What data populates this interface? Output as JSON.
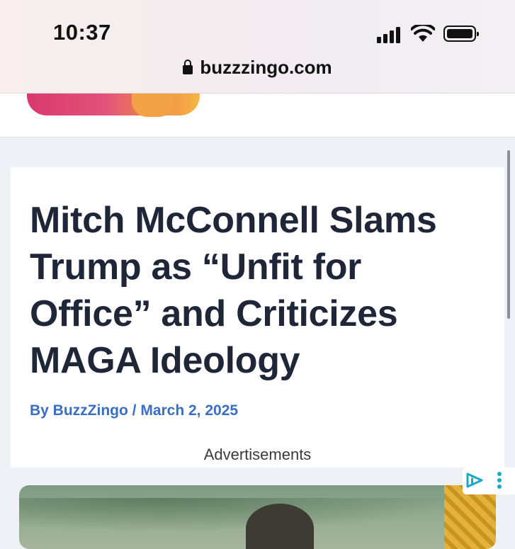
{
  "status_bar": {
    "time": "10:37"
  },
  "browser": {
    "url": "buzzzingo.com"
  },
  "article": {
    "title": "Mitch McConnell Slams Trump as “Unfit for Office” and Criticizes MAGA Ideology",
    "byline": "By BuzzZingo / March 2, 2025"
  },
  "ads": {
    "label": "Advertisements"
  },
  "colors": {
    "title": "#1e2638",
    "byline": "#3a6dc4",
    "accent": "#19a9c9"
  }
}
